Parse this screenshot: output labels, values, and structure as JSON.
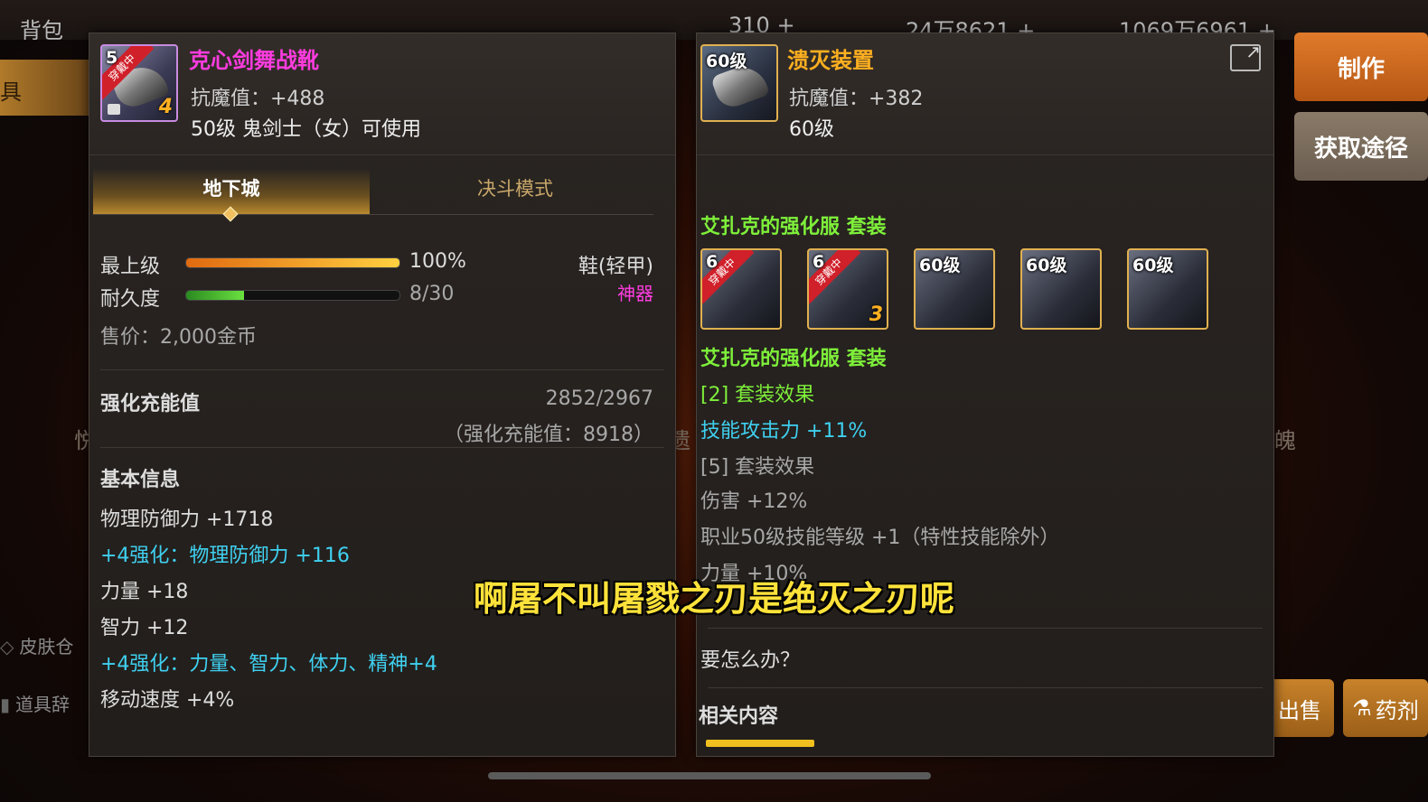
{
  "topbar": {
    "bag_label": "背包",
    "currency1": "310 +",
    "currency2": "24万8621 +",
    "currency3": "1069万6961 +"
  },
  "left_nav": {
    "active_tab": "具",
    "skin_warehouse": "皮肤仓",
    "item_dictionary": "道具辞"
  },
  "right_buttons": {
    "make": "制作",
    "source": "获取途径"
  },
  "bottom_buttons": {
    "sell": "出售",
    "potion": "药剂"
  },
  "background_row": {
    "left_text": "悦",
    "mid_text": "遗",
    "right_text": "魄"
  },
  "left_item": {
    "name": "克心剑舞战靴",
    "name_color": "#ff3ce0",
    "magic_resist": "抗魔值：+488",
    "requirement": "50级 鬼剑士（女）可使用",
    "icon_level": "5",
    "wear_badge": "穿戴中",
    "enhance_badge": "4",
    "tabs": [
      "地下城",
      "决斗模式"
    ],
    "grade_label": "最上级",
    "grade_value": "100%",
    "grade_fraction": 1.0,
    "durability_label": "耐久度",
    "durability_value": "8/30",
    "durability_fraction": 0.267,
    "type_label": "鞋(轻甲)",
    "rarity_label": "神器",
    "price": "售价：2,000金币",
    "charge_label": "强化充能值",
    "charge_value": "2852/2967",
    "charge_total": "（强化充能值：8918）",
    "basic_info_title": "基本信息",
    "stats": [
      {
        "text": "物理防御力 +1718",
        "color": "normal"
      },
      {
        "text": "+4强化：物理防御力 +116",
        "color": "cyan"
      },
      {
        "text": "力量 +18",
        "color": "normal"
      },
      {
        "text": "智力 +12",
        "color": "normal"
      },
      {
        "text": "+4强化：力量、智力、体力、精神+4",
        "color": "cyan"
      },
      {
        "text": "移动速度 +4%",
        "color": "normal"
      }
    ]
  },
  "right_item": {
    "name": "溃灭装置",
    "name_color": "#ffb020",
    "magic_resist": "抗魔值：+382",
    "level": "60级",
    "icon_level": "60级",
    "set_title": "艾扎克的强化服  套装",
    "set_items": [
      {
        "level": "6",
        "badge": "穿戴中",
        "enhance": ""
      },
      {
        "level": "6",
        "badge": "穿戴中",
        "enhance": "3"
      },
      {
        "level": "60级",
        "badge": "",
        "enhance": ""
      },
      {
        "level": "60级",
        "badge": "",
        "enhance": ""
      },
      {
        "level": "60级",
        "badge": "",
        "enhance": ""
      }
    ],
    "set_title2": "艾扎克的强化服  套装",
    "effect2_title": "[2] 套装效果",
    "effect2_line": "技能攻击力 +11%",
    "effect5_title": "[5] 套装效果",
    "effect5_lines": [
      "伤害 +12%",
      "职业50级技能等级 +1（特性技能除外）",
      "力量 +10%"
    ],
    "question": "要怎么办？",
    "related": "相关内容"
  },
  "subtitle": "啊屠不叫屠戮之刃是绝灭之刃呢",
  "colors": {
    "cyan": "#3fd0f0",
    "green": "#7ef03a",
    "magenta": "#ff3ce0",
    "gold": "#ffb020",
    "subtitle": "#ffe23a"
  }
}
